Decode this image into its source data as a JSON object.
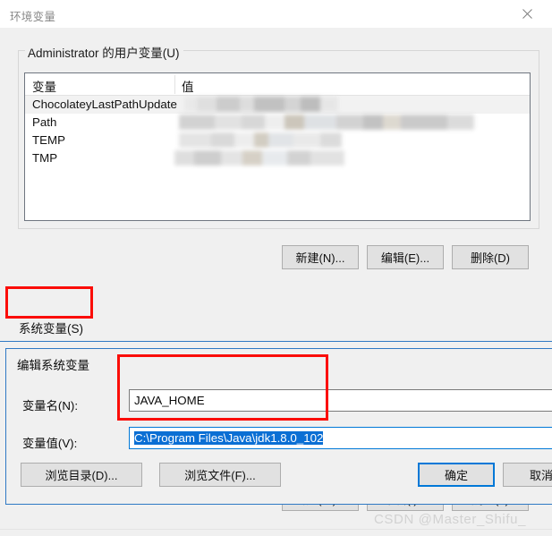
{
  "window": {
    "title": "环境变量",
    "close_icon": "close-icon"
  },
  "user_variables": {
    "legend": "Administrator 的用户变量(U)",
    "columns": [
      "变量",
      "值"
    ],
    "rows": [
      {
        "name": "ChocolateyLastPathUpdate",
        "value_redacted": true,
        "selected": true
      },
      {
        "name": "Path",
        "value_redacted": true,
        "selected": false
      },
      {
        "name": "TEMP",
        "value_redacted": true,
        "selected": false
      },
      {
        "name": "TMP",
        "value_redacted": true,
        "selected": false
      }
    ],
    "buttons": {
      "new": "新建(N)...",
      "edit": "编辑(E)...",
      "delete": "删除(D)"
    }
  },
  "system_variables": {
    "label": "系统变量(S)",
    "buttons": {
      "new": "新建(W)...",
      "edit": "编辑(I)...",
      "delete": "删除(L)"
    }
  },
  "edit_dialog": {
    "title": "编辑系统变量",
    "name_label": "变量名(N):",
    "name_value": "JAVA_HOME",
    "value_label": "变量值(V):",
    "value_value": "C:\\Program Files\\Java\\jdk1.8.0_102",
    "browse_dir": "浏览目录(D)...",
    "browse_file": "浏览文件(F)...",
    "ok": "确定",
    "cancel": "取消"
  },
  "annotations": {
    "highlight_color": "#fb0d08",
    "accent_color": "#0078d7",
    "selection_color": "#0b6fd4"
  },
  "watermark": "CSDN @Master_Shifu_"
}
